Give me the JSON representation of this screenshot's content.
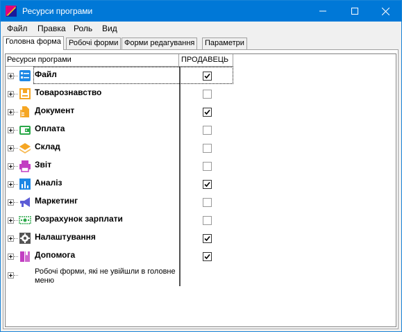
{
  "window": {
    "title": "Ресурси програми",
    "controls": {
      "minimize": "minimize",
      "maximize": "maximize",
      "close": "close"
    }
  },
  "menu": {
    "items": [
      "Файл",
      "Правка",
      "Роль",
      "Вид"
    ]
  },
  "tabs": [
    {
      "label": "Головна форма",
      "active": true
    },
    {
      "label": "Робочі форми",
      "active": false
    },
    {
      "label": "Форми редагування",
      "active": false
    },
    {
      "label": "Параметри",
      "active": false
    }
  ],
  "grid": {
    "columns": [
      "Ресурси програми",
      "ПРОДАВЕЦЬ"
    ],
    "rows": [
      {
        "label": "Файл",
        "icon": "file-menu-icon",
        "color": "#1e88e5",
        "checked": true
      },
      {
        "label": "Товарознавство",
        "icon": "goods-box-icon",
        "color": "#f5a623",
        "checked": false
      },
      {
        "label": "Документ",
        "icon": "document-icon",
        "color": "#f5a623",
        "checked": true
      },
      {
        "label": "Оплата",
        "icon": "wallet-icon",
        "color": "#2ba84a",
        "checked": false
      },
      {
        "label": "Склад",
        "icon": "warehouse-layers-icon",
        "color": "#f5a623",
        "checked": false
      },
      {
        "label": "Звіт",
        "icon": "printer-icon",
        "color": "#c23ec2",
        "checked": false
      },
      {
        "label": "Аналіз",
        "icon": "bar-chart-icon",
        "color": "#1e88e5",
        "checked": true
      },
      {
        "label": "Маркетинг",
        "icon": "megaphone-icon",
        "color": "#5c5cd6",
        "checked": false
      },
      {
        "label": "Розрахунок зарплати",
        "icon": "banknote-icon",
        "color": "#2ba84a",
        "checked": false
      },
      {
        "label": "Налаштування",
        "icon": "gear-icon",
        "color": "#555555",
        "checked": true
      },
      {
        "label": "Допомога",
        "icon": "help-book-icon",
        "color": "#c23ec2",
        "checked": true
      }
    ],
    "extra_row": {
      "label": "Робочі форми, які не увійшли в головне меню"
    }
  }
}
